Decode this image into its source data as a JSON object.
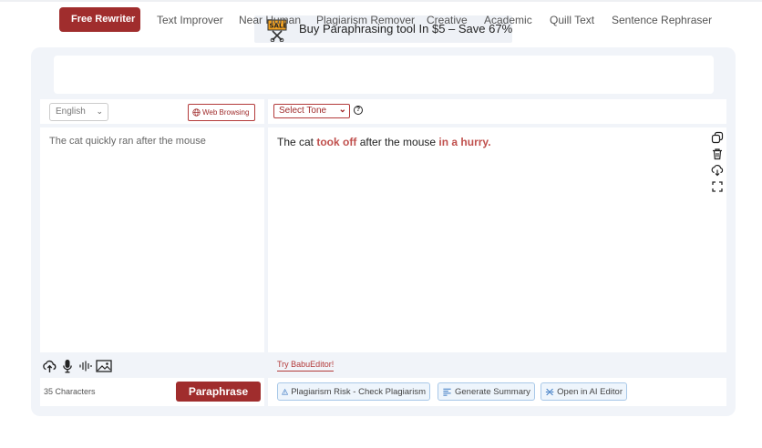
{
  "promo": {
    "badge": "SALE",
    "text": "Buy Paraphrasing tool In $5 – Save 67%"
  },
  "tabs": [
    {
      "label": "Free Rewriter"
    },
    {
      "label": "Text Improver"
    },
    {
      "label": "Near Human"
    },
    {
      "label": "Plagiarism Remover"
    },
    {
      "label": "Creative"
    },
    {
      "label": "Academic"
    },
    {
      "label": "Quill Text"
    },
    {
      "label": "Sentence Rephraser"
    }
  ],
  "left": {
    "language": "English",
    "web_browsing": "Web Browsing",
    "input_text": "The cat quickly ran after the mouse",
    "char_count": "35 Characters",
    "paraphrase_button": "Paraphrase"
  },
  "right": {
    "tone_select": "Select Tone",
    "output_parts": [
      "The cat ",
      "took off",
      " after the mouse ",
      "in a hurry."
    ],
    "try_link": "Try BabuEditor!",
    "actions": [
      "Plagiarism Risk - Check Plagiarism",
      "Generate Summary",
      "Open in AI Editor"
    ]
  },
  "colors": {
    "accent": "#a02d2d",
    "highlight": "#c0504d",
    "panel_bg": "#f1f4f9",
    "action_border": "#a8c8e8"
  },
  "icons": {
    "side": [
      "copy-icon",
      "trash-icon",
      "download-icon",
      "fullscreen-icon"
    ],
    "left_footer": [
      "upload-icon",
      "microphone-icon",
      "audio-wave-icon",
      "image-icon"
    ]
  }
}
